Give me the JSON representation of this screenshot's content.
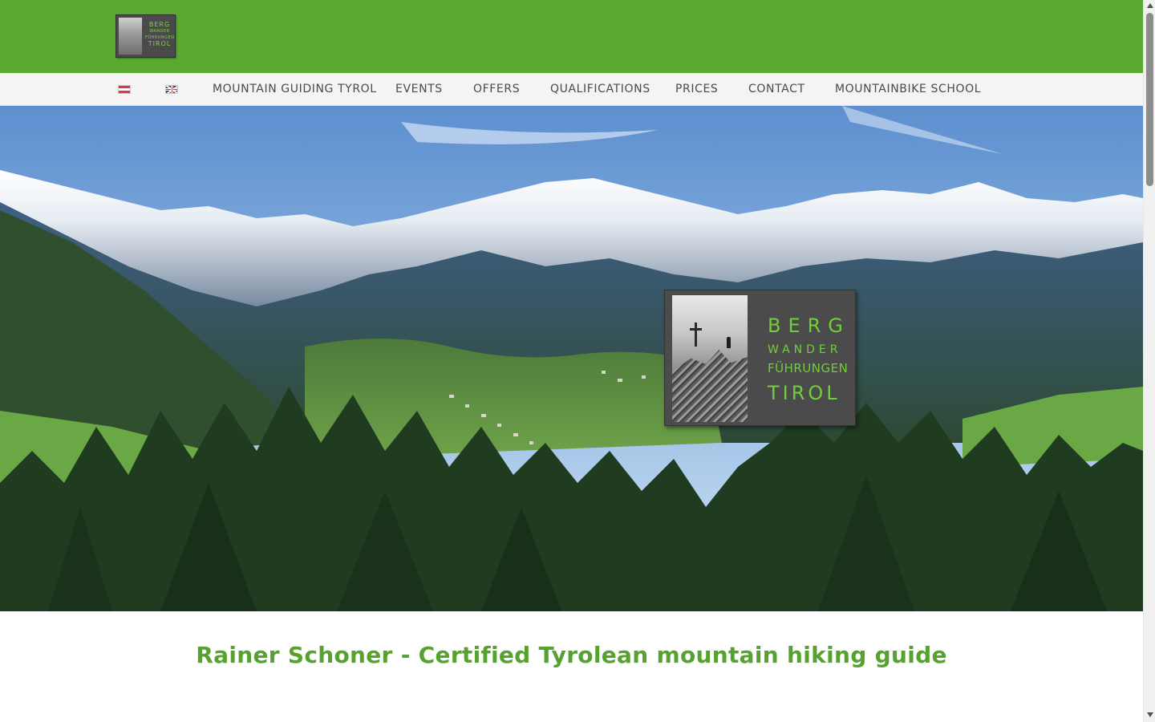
{
  "header": {
    "logo": {
      "line1": "BERG",
      "line2": "WANDER",
      "line3": "FÜHRUNGEN",
      "line4": "TIROL"
    }
  },
  "nav": {
    "flags": [
      "austria-flag-icon",
      "uk-flag-icon"
    ],
    "items": [
      "MOUNTAIN GUIDING TYROL",
      "EVENTS",
      "OFFERS",
      "QUALIFICATIONS",
      "PRICES",
      "CONTACT",
      "MOUNTAINBIKE SCHOOL"
    ]
  },
  "hero": {
    "logo": {
      "line1": "BERG",
      "line2": "WANDER",
      "line3": "FÜHRUNGEN",
      "line4": "TIROL"
    }
  },
  "main": {
    "title": "Rainer Schoner - Certified Tyrolean mountain hiking guide"
  },
  "colors": {
    "brand_green": "#5aaa32",
    "title_green": "#55a22e",
    "nav_bg": "#f5f4f4"
  }
}
